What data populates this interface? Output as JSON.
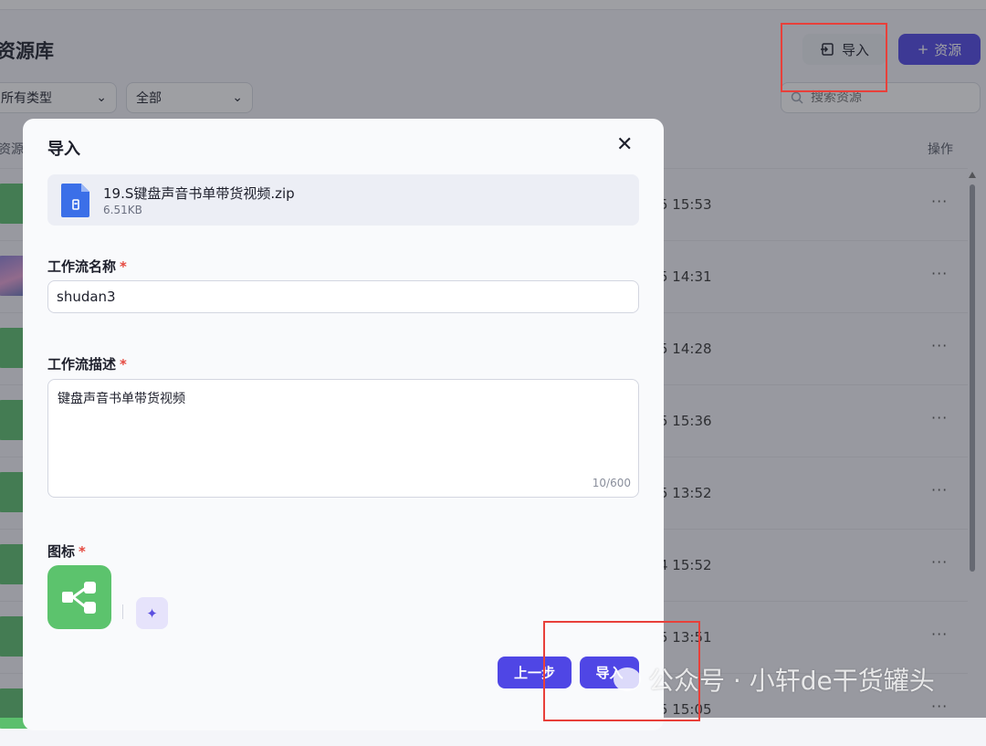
{
  "page": {
    "title": "资源库",
    "import_button": "导入",
    "add_button": "资源",
    "type_filter": "所有类型",
    "scope_filter": "全部",
    "search_placeholder": "搜索资源"
  },
  "table": {
    "headers": {
      "resource": "资源",
      "actions": "操作"
    },
    "rows": [
      {
        "time": "5 15:53",
        "icon": "workflow-icon",
        "more": "···"
      },
      {
        "time": "5 14:31",
        "icon": "image-thumbnail",
        "more": "···"
      },
      {
        "time": "5 14:28",
        "icon": "workflow-icon",
        "more": "···"
      },
      {
        "time": "5 15:36",
        "icon": "workflow-icon",
        "more": "···"
      },
      {
        "time": "5 13:52",
        "icon": "workflow-icon",
        "more": "···"
      },
      {
        "time": "4 15:52",
        "icon": "workflow-icon",
        "more": "···"
      },
      {
        "time": "5 13:51",
        "icon": "workflow-icon",
        "more": "···"
      },
      {
        "time": "5 15:05",
        "icon": "workflow-icon",
        "more": "···"
      }
    ]
  },
  "modal": {
    "title": "导入",
    "file": {
      "name": "19.S键盘声音书单带货视频.zip",
      "size": "6.51KB"
    },
    "name_label": "工作流名称",
    "name_value": "shudan3",
    "desc_label": "工作流描述",
    "desc_value": "键盘声音书单带货视频",
    "desc_counter": "10/600",
    "icon_label": "图标",
    "required_mark": "*",
    "prev_button": "上一步",
    "import_button": "导入"
  },
  "watermark": "公众号 · 小轩de干货罐头",
  "colors": {
    "accent": "#4f46e5",
    "workflow_green": "#5cc36d",
    "highlight_red": "#e8403a"
  }
}
